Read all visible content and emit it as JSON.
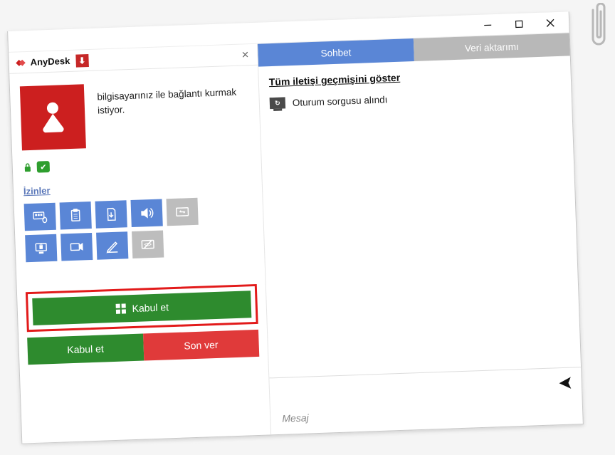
{
  "app": {
    "name": "AnyDesk"
  },
  "window_controls": {
    "min": "—",
    "max": "▢",
    "close": "✕"
  },
  "tab_close_glyph": "×",
  "request": {
    "text": "bilgisayarınız ile bağlantı kurmak istiyor."
  },
  "permissions": {
    "label": "İzinler",
    "items": [
      {
        "name": "keyboard-mouse",
        "enabled": true
      },
      {
        "name": "clipboard",
        "enabled": true
      },
      {
        "name": "file-transfer",
        "enabled": true
      },
      {
        "name": "audio",
        "enabled": true
      },
      {
        "name": "display-switch",
        "enabled": false
      },
      {
        "name": "lock",
        "enabled": true
      },
      {
        "name": "record",
        "enabled": true
      },
      {
        "name": "draw",
        "enabled": true
      },
      {
        "name": "privacy",
        "enabled": false
      }
    ]
  },
  "buttons": {
    "accept_main": "Kabul et",
    "accept": "Kabul et",
    "reject": "Son ver"
  },
  "tabs": {
    "chat": "Sohbet",
    "transfer": "Veri aktarımı"
  },
  "chat": {
    "history_link": "Tüm iletişi geçmişini göster",
    "log_entry": "Oturum sorgusu alındı",
    "message_placeholder": "Mesaj"
  }
}
